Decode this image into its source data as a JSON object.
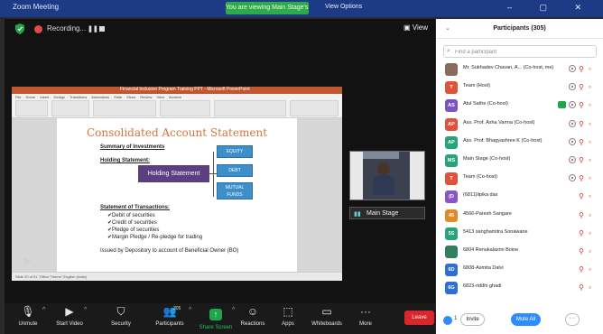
{
  "window": {
    "title": "Zoom Meeting",
    "view_banner": "You are viewing Main Stage's screen",
    "view_options": "View Options",
    "controls": "–  ▢  ✕"
  },
  "meeting_bar": {
    "recording": "Recording...",
    "pause_label": "❚❚",
    "view_label": "View"
  },
  "powerpoint": {
    "title": "Financial Inclusion Program Training PPT - Microsoft PowerPoint",
    "tabs": "File Home Insert Design Transitions Animations Slide Show Review View Acrobat",
    "status": "Slide 20 of 51   \"Office Theme\"   English (India)"
  },
  "slide": {
    "title": "Consolidated Account Statement",
    "summary": "Summary of Investments",
    "holding_label": "Holding Statement:",
    "holding_box": "Holding Statement",
    "equity": "EQUITY",
    "debt": "DEBT",
    "mutual_funds": "MUTUAL FUNDS",
    "transactions_label": "Statement of Transactions:",
    "bullets": [
      "✔Debit of securities",
      "✔Credit of securities",
      "✔Pledge of securities",
      "✔Margin Pledge / Re-pledge for trading"
    ],
    "footer": "Issued by Depository to account of Beneficial Owner (BO)"
  },
  "video": {
    "stage_label": "Main Stage"
  },
  "toolbar": {
    "items": [
      {
        "label": "Unmute",
        "icon": "mic-muted-icon"
      },
      {
        "label": "Start Video",
        "icon": "video-off-icon"
      },
      {
        "label": "Security",
        "icon": "shield-icon"
      },
      {
        "label": "Participants",
        "icon": "people-icon",
        "count": "305"
      },
      {
        "label": "Share Screen",
        "icon": "share-screen-icon"
      },
      {
        "label": "Reactions",
        "icon": "reactions-icon"
      },
      {
        "label": "Apps",
        "icon": "apps-icon"
      },
      {
        "label": "Whiteboards",
        "icon": "whiteboard-icon"
      },
      {
        "label": "More",
        "icon": "more-icon"
      }
    ],
    "leave": "Leave"
  },
  "participants": {
    "title": "Participants (305)",
    "search_placeholder": "Find a participant",
    "list": [
      {
        "initials": "",
        "name": "Mr. Sukhadev Chavan, A... (Co-host, me)",
        "color": "#8a6a5a",
        "photo": true,
        "share": false,
        "rec": true
      },
      {
        "initials": "T",
        "name": "Team (Host)",
        "color": "#e0533b",
        "photo": false,
        "share": false,
        "rec": true
      },
      {
        "initials": "AS",
        "name": "Atul Sathe (Co-host)",
        "color": "#7b55c7",
        "photo": false,
        "share": true,
        "rec": true
      },
      {
        "initials": "AP",
        "name": "Ass. Prof. Asha Varma (Co-host)",
        "color": "#e0533b",
        "photo": false,
        "share": false,
        "rec": true
      },
      {
        "initials": "AP",
        "name": "Ass. Prof. Bhagyashree K (Co-host)",
        "color": "#27a577",
        "photo": false,
        "share": false,
        "rec": true
      },
      {
        "initials": "MS",
        "name": "Main Stage (Co-host)",
        "color": "#27a577",
        "photo": false,
        "share": false,
        "rec": true
      },
      {
        "initials": "T",
        "name": "Team (Co-host)",
        "color": "#e0533b",
        "photo": false,
        "share": false,
        "rec": true
      },
      {
        "initials": "(D",
        "name": "(6811)lipika das",
        "color": "#8a56c9",
        "photo": false,
        "share": false,
        "rec": false
      },
      {
        "initials": "45",
        "name": "4566-Paresh Sangare",
        "color": "#e08a2a",
        "photo": false,
        "share": false,
        "rec": false
      },
      {
        "initials": "5S",
        "name": "5413 sanghamitra Sonawane",
        "color": "#27a577",
        "photo": false,
        "share": false,
        "rec": false
      },
      {
        "initials": "",
        "name": "6804 Renukalaxmi Boine",
        "color": "#2f7f5f",
        "photo": true,
        "share": false,
        "rec": false
      },
      {
        "initials": "6D",
        "name": "6808-Asmita Dalvi",
        "color": "#2d6fd6",
        "photo": false,
        "share": false,
        "rec": false
      },
      {
        "initials": "6G",
        "name": "6823-riddhi ghadi",
        "color": "#2d6fd6",
        "photo": false,
        "share": false,
        "rec": false
      }
    ],
    "more_count": "1",
    "invite": "Invite",
    "mute_all": "Mute All",
    "more": "···"
  }
}
